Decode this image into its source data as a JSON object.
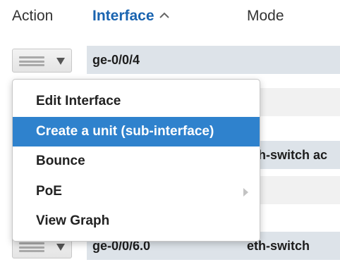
{
  "table": {
    "headers": {
      "action": "Action",
      "interface": "Interface",
      "mode": "Mode"
    },
    "sort_icon": "chevron-up-icon",
    "rows": [
      {
        "interface": "ge-0/0/4",
        "mode": ""
      },
      {
        "interface": "",
        "mode": ""
      },
      {
        "interface": "",
        "mode": "eth-switch ac"
      },
      {
        "interface": "",
        "mode": ""
      },
      {
        "interface": "ge-0/0/6.0",
        "mode": "eth-switch"
      }
    ]
  },
  "action_menu": {
    "items": [
      {
        "label": "Edit Interface"
      },
      {
        "label": "Create a unit (sub-interface)",
        "active": true
      },
      {
        "label": "Bounce"
      },
      {
        "label": "PoE",
        "has_submenu": true
      },
      {
        "label": "View Graph"
      }
    ]
  },
  "colors": {
    "accent": "#1a64b0",
    "menu_highlight": "#2f82cd",
    "row_shade": "#dde3e9",
    "row_light": "#f1f1f1"
  }
}
